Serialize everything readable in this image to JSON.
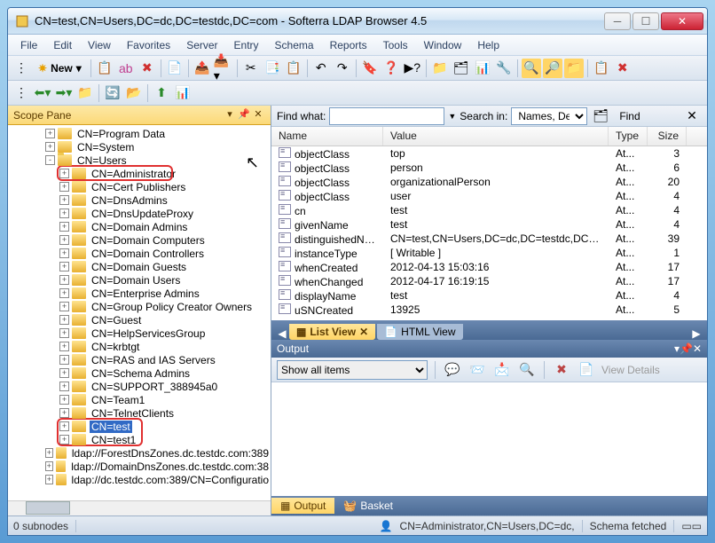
{
  "title": "CN=test,CN=Users,DC=dc,DC=testdc,DC=com - Softerra LDAP Browser 4.5",
  "menus": [
    "File",
    "Edit",
    "View",
    "Favorites",
    "Server",
    "Entry",
    "Schema",
    "Reports",
    "Tools",
    "Window",
    "Help"
  ],
  "newLabel": "New",
  "scopePane": {
    "title": "Scope Pane"
  },
  "tree": [
    {
      "indent": 2,
      "exp": "+",
      "label": "CN=Program Data"
    },
    {
      "indent": 2,
      "exp": "+",
      "label": "CN=System"
    },
    {
      "indent": 2,
      "exp": "-",
      "label": "CN=Users",
      "open": true
    },
    {
      "indent": 3,
      "exp": "+",
      "label": "CN=Administrator"
    },
    {
      "indent": 3,
      "exp": "+",
      "label": "CN=Cert Publishers"
    },
    {
      "indent": 3,
      "exp": "+",
      "label": "CN=DnsAdmins"
    },
    {
      "indent": 3,
      "exp": "+",
      "label": "CN=DnsUpdateProxy"
    },
    {
      "indent": 3,
      "exp": "+",
      "label": "CN=Domain Admins"
    },
    {
      "indent": 3,
      "exp": "+",
      "label": "CN=Domain Computers"
    },
    {
      "indent": 3,
      "exp": "+",
      "label": "CN=Domain Controllers"
    },
    {
      "indent": 3,
      "exp": "+",
      "label": "CN=Domain Guests"
    },
    {
      "indent": 3,
      "exp": "+",
      "label": "CN=Domain Users"
    },
    {
      "indent": 3,
      "exp": "+",
      "label": "CN=Enterprise Admins"
    },
    {
      "indent": 3,
      "exp": "+",
      "label": "CN=Group Policy Creator Owners"
    },
    {
      "indent": 3,
      "exp": "+",
      "label": "CN=Guest"
    },
    {
      "indent": 3,
      "exp": "+",
      "label": "CN=HelpServicesGroup"
    },
    {
      "indent": 3,
      "exp": "+",
      "label": "CN=krbtgt"
    },
    {
      "indent": 3,
      "exp": "+",
      "label": "CN=RAS and IAS Servers"
    },
    {
      "indent": 3,
      "exp": "+",
      "label": "CN=Schema Admins"
    },
    {
      "indent": 3,
      "exp": "+",
      "label": "CN=SUPPORT_388945a0"
    },
    {
      "indent": 3,
      "exp": "+",
      "label": "CN=Team1"
    },
    {
      "indent": 3,
      "exp": "+",
      "label": "CN=TelnetClients"
    },
    {
      "indent": 3,
      "exp": "+",
      "label": "CN=test",
      "selected": true
    },
    {
      "indent": 3,
      "exp": "+",
      "label": "CN=test1"
    },
    {
      "indent": 2,
      "exp": "+",
      "label": "ldap://ForestDnsZones.dc.testdc.com:389"
    },
    {
      "indent": 2,
      "exp": "+",
      "label": "ldap://DomainDnsZones.dc.testdc.com:38"
    },
    {
      "indent": 2,
      "exp": "+",
      "label": "ldap://dc.testdc.com:389/CN=Configuratio"
    }
  ],
  "find": {
    "label": "Find what:",
    "searchInLabel": "Search in:",
    "searchIn": "Names, Desc",
    "button": "Find"
  },
  "columns": {
    "name": "Name",
    "value": "Value",
    "type": "Type",
    "size": "Size"
  },
  "rows": [
    {
      "name": "objectClass",
      "value": "top",
      "type": "At...",
      "size": "3"
    },
    {
      "name": "objectClass",
      "value": "person",
      "type": "At...",
      "size": "6"
    },
    {
      "name": "objectClass",
      "value": "organizationalPerson",
      "type": "At...",
      "size": "20"
    },
    {
      "name": "objectClass",
      "value": "user",
      "type": "At...",
      "size": "4"
    },
    {
      "name": "cn",
      "value": "test",
      "type": "At...",
      "size": "4"
    },
    {
      "name": "givenName",
      "value": "test",
      "type": "At...",
      "size": "4"
    },
    {
      "name": "distinguishedName",
      "value": "CN=test,CN=Users,DC=dc,DC=testdc,DC=com",
      "type": "At...",
      "size": "39"
    },
    {
      "name": "instanceType",
      "value": "[ Writable ]",
      "type": "At...",
      "size": "1"
    },
    {
      "name": "whenCreated",
      "value": "2012-04-13 15:03:16",
      "type": "At...",
      "size": "17"
    },
    {
      "name": "whenChanged",
      "value": "2012-04-17 16:19:15",
      "type": "At...",
      "size": "17"
    },
    {
      "name": "displayName",
      "value": "test",
      "type": "At...",
      "size": "4"
    },
    {
      "name": "uSNCreated",
      "value": "13925",
      "type": "At...",
      "size": "5"
    }
  ],
  "tabs": {
    "list": "List View",
    "html": "HTML View"
  },
  "output": {
    "title": "Output",
    "filter": "Show all items",
    "viewDetails": "View Details"
  },
  "bottomTabs": {
    "output": "Output",
    "basket": "Basket"
  },
  "status": {
    "subnodes": "0 subnodes",
    "path": "CN=Administrator,CN=Users,DC=dc,",
    "fetched": "Schema fetched"
  }
}
